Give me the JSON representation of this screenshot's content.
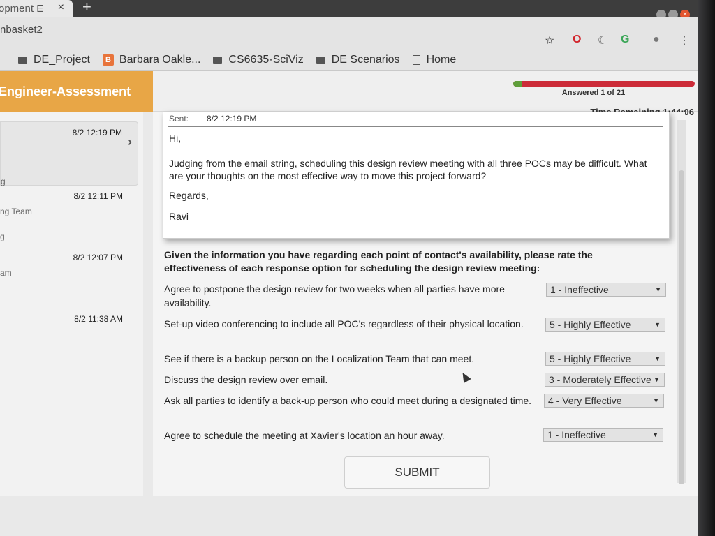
{
  "browser": {
    "tab_title": "opment E",
    "tab_close": "×",
    "new_tab": "+",
    "url": "nbasket2",
    "bookmarks": [
      {
        "label": "DE_Project",
        "icon": "folder-icon"
      },
      {
        "label": "Barbara Oakle...",
        "icon": "blogger-icon"
      },
      {
        "label": "CS6635-SciViz",
        "icon": "folder-icon"
      },
      {
        "label": "DE Scenarios",
        "icon": "folder-icon"
      },
      {
        "label": "Home",
        "icon": "page-icon"
      }
    ]
  },
  "app": {
    "brand": "Engineer-Assessment",
    "answered": "Answered 1 of 21",
    "progress": 0.048,
    "time_remaining": "Time Remaining 1:44:06"
  },
  "inbox": {
    "messages": [
      {
        "time": "8/2 12:19 PM",
        "from": "g"
      },
      {
        "time": "8/2 12:11 PM",
        "from": "ng Team"
      },
      {
        "time": "8/2 12:07 PM",
        "from": "g"
      },
      {
        "time": "8/2 11:38 AM",
        "from": "am"
      }
    ]
  },
  "email": {
    "sent_label": "Sent:",
    "sent_value": "8/2 12:19 PM",
    "greeting": "Hi,",
    "body": "Judging from the email string, scheduling this design review meeting with all three POCs may be difficult. What are your thoughts on the most effective way to move this project forward?",
    "closing": "Regards,",
    "signature": "Ravi"
  },
  "question": "Given the information you have regarding each point of contact's availability, please rate the effectiveness of each response option for scheduling the design review meeting:",
  "options": [
    {
      "text": "Agree to postpone the design review for two weeks when all parties have more availability.",
      "rating": "1 - Ineffective"
    },
    {
      "text": "Set-up video conferencing to include all POC's regardless of their physical location.",
      "rating": "5 - Highly Effective"
    },
    {
      "text": "See if there is a backup person on the Localization Team that can meet.",
      "rating": "5 - Highly Effective"
    },
    {
      "text": "Discuss the design review over email.",
      "rating": "3 - Moderately Effective"
    },
    {
      "text": "Ask all parties to identify a back-up person who could meet during a designated time.",
      "rating": "4 - Very Effective"
    },
    {
      "text": "Agree to schedule the meeting at Xavier's location an hour away.",
      "rating": "1 - Ineffective"
    }
  ],
  "submit_label": "SUBMIT",
  "colors": {
    "brand": "#e8a646",
    "progress_bg": "#cc2b38",
    "progress_fill": "#5f9e3a"
  }
}
